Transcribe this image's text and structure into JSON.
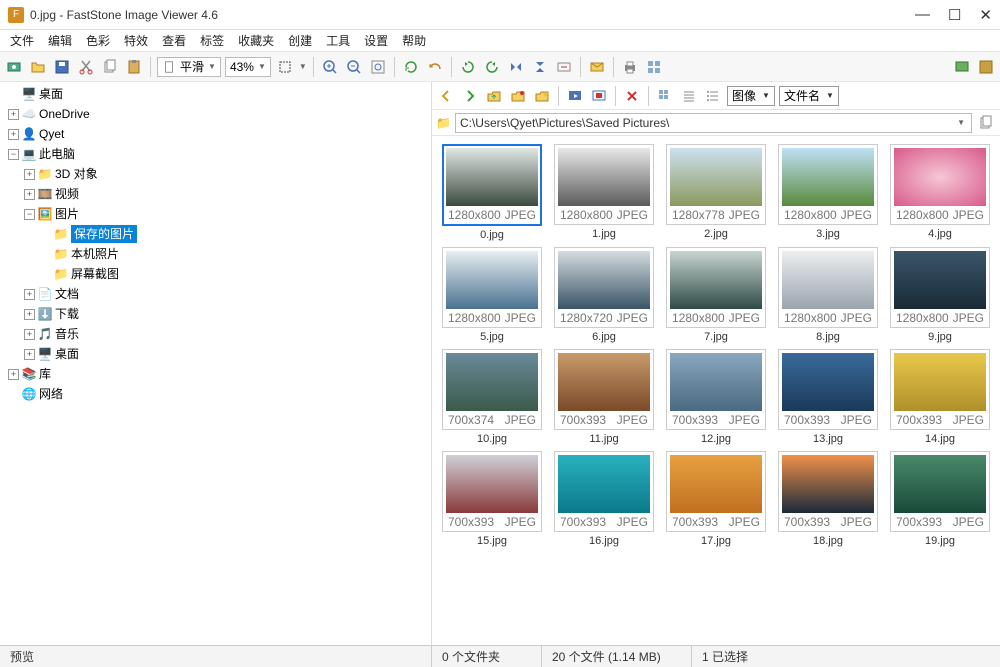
{
  "titlebar": {
    "title": "0.jpg  -  FastStone Image Viewer 4.6"
  },
  "menubar": [
    "文件",
    "编辑",
    "色彩",
    "特效",
    "查看",
    "标签",
    "收藏夹",
    "创建",
    "工具",
    "设置",
    "帮助"
  ],
  "toolbar1": {
    "zoom_label": "平滑",
    "zoom_value": "43%"
  },
  "tree": {
    "desktop": "桌面",
    "onedrive": "OneDrive",
    "user": "Qyet",
    "thispc": "此电脑",
    "children": {
      "obj3d": "3D 对象",
      "video": "视频",
      "pictures": "图片",
      "saved_pictures": "保存的图片",
      "local_photos": "本机照片",
      "screenshots": "屏幕截图",
      "documents": "文档",
      "downloads": "下载",
      "music": "音乐",
      "desktop2": "桌面"
    },
    "libraries": "库",
    "network": "网络"
  },
  "toolbar2": {
    "dd1": "图像",
    "dd2": "文件名"
  },
  "path": "C:\\Users\\Qyet\\Pictures\\Saved Pictures\\",
  "thumbs": [
    {
      "name": "0.jpg",
      "dim": "1280x800",
      "fmt": "JPEG",
      "g": "g0",
      "sel": true
    },
    {
      "name": "1.jpg",
      "dim": "1280x800",
      "fmt": "JPEG",
      "g": "g1"
    },
    {
      "name": "2.jpg",
      "dim": "1280x778",
      "fmt": "JPEG",
      "g": "g2"
    },
    {
      "name": "3.jpg",
      "dim": "1280x800",
      "fmt": "JPEG",
      "g": "g3"
    },
    {
      "name": "4.jpg",
      "dim": "1280x800",
      "fmt": "JPEG",
      "g": "g4"
    },
    {
      "name": "5.jpg",
      "dim": "1280x800",
      "fmt": "JPEG",
      "g": "g5"
    },
    {
      "name": "6.jpg",
      "dim": "1280x720",
      "fmt": "JPEG",
      "g": "g6"
    },
    {
      "name": "7.jpg",
      "dim": "1280x800",
      "fmt": "JPEG",
      "g": "g7"
    },
    {
      "name": "8.jpg",
      "dim": "1280x800",
      "fmt": "JPEG",
      "g": "g8"
    },
    {
      "name": "9.jpg",
      "dim": "1280x800",
      "fmt": "JPEG",
      "g": "g9"
    },
    {
      "name": "10.jpg",
      "dim": "700x374",
      "fmt": "JPEG",
      "g": "g10"
    },
    {
      "name": "11.jpg",
      "dim": "700x393",
      "fmt": "JPEG",
      "g": "g11"
    },
    {
      "name": "12.jpg",
      "dim": "700x393",
      "fmt": "JPEG",
      "g": "g12"
    },
    {
      "name": "13.jpg",
      "dim": "700x393",
      "fmt": "JPEG",
      "g": "g13"
    },
    {
      "name": "14.jpg",
      "dim": "700x393",
      "fmt": "JPEG",
      "g": "g14"
    },
    {
      "name": "15.jpg",
      "dim": "700x393",
      "fmt": "JPEG",
      "g": "g15"
    },
    {
      "name": "16.jpg",
      "dim": "700x393",
      "fmt": "JPEG",
      "g": "g16"
    },
    {
      "name": "17.jpg",
      "dim": "700x393",
      "fmt": "JPEG",
      "g": "g17"
    },
    {
      "name": "18.jpg",
      "dim": "700x393",
      "fmt": "JPEG",
      "g": "g18"
    },
    {
      "name": "19.jpg",
      "dim": "700x393",
      "fmt": "JPEG",
      "g": "g19"
    }
  ],
  "status": {
    "preview": "预览",
    "folders": "0 个文件夹",
    "files": "20 个文件 (1.14 MB)",
    "selected": "1 已选择"
  }
}
